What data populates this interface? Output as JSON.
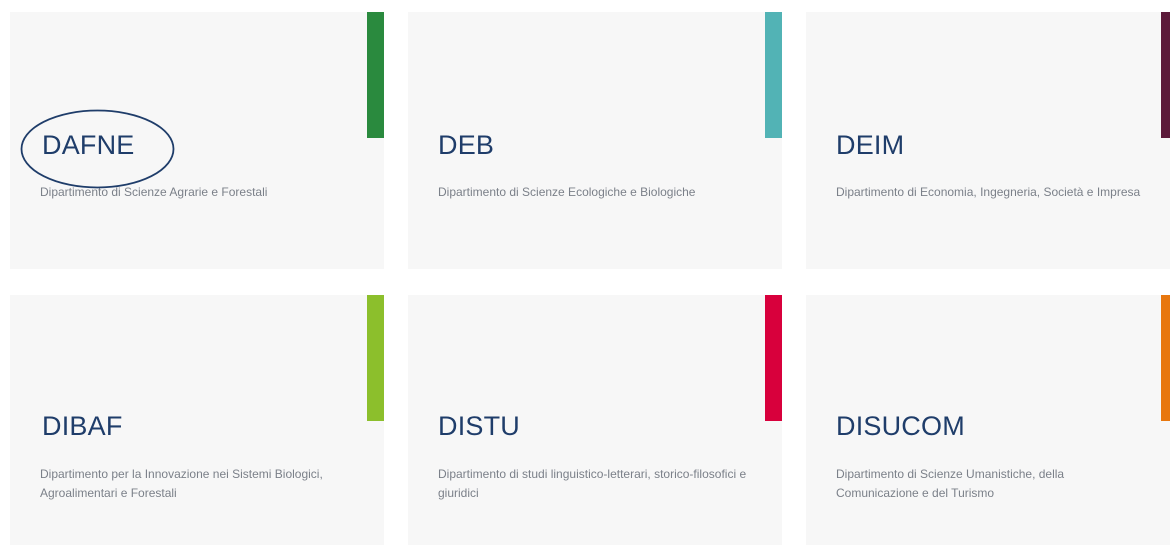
{
  "departments": [
    {
      "code": "DAFNE",
      "description": "Dipartimento di Scienze Agrarie e Forestali",
      "accent_color": "#2a8a3e"
    },
    {
      "code": "DEB",
      "description": "Dipartimento di Scienze Ecologiche e Biologiche",
      "accent_color": "#52b3b5"
    },
    {
      "code": "DEIM",
      "description": "Dipartimento di Economia, Ingegneria, Società e Impresa",
      "accent_color": "#5c1a3a"
    },
    {
      "code": "DIBAF",
      "description": "Dipartimento per la Innovazione nei Sistemi Biologici, Agroalimentari e Forestali",
      "accent_color": "#8cbf2c"
    },
    {
      "code": "DISTU",
      "description": "Dipartimento di studi linguistico-letterari, storico-filosofici e giuridici",
      "accent_color": "#d8003c"
    },
    {
      "code": "DISUCOM",
      "description": "Dipartimento di Scienze Umanistiche, della Comunicazione e del Turismo",
      "accent_color": "#e8770e"
    }
  ],
  "annotation": {
    "ellipse_color": "#1f3d6a"
  }
}
